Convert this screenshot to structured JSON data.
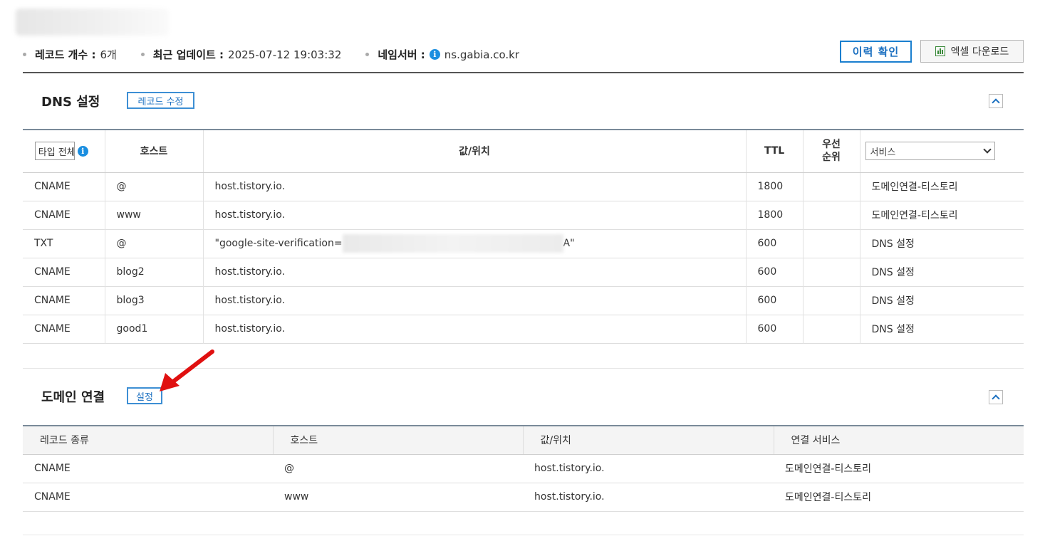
{
  "summary": {
    "record_count_label": "레코드 개수 :",
    "record_count_value": "6개",
    "last_update_label": "최근 업데이트 :",
    "last_update_value": "2025-07-12 19:03:32",
    "nameserver_label": "네임서버 :",
    "nameserver_value": "ns.gabia.co.kr"
  },
  "buttons": {
    "history": "이력 확인",
    "excel_download": "엑셀 다운로드"
  },
  "dns": {
    "title": "DNS 설정",
    "edit_button": "레코드 수정",
    "headers": {
      "type_select": "타입 전체",
      "host": "호스트",
      "value": "값/위치",
      "ttl": "TTL",
      "priority_line1": "우선",
      "priority_line2": "순위",
      "service_select": "서비스"
    },
    "rows": [
      {
        "type": "CNAME",
        "host": "@",
        "value": "host.tistory.io.",
        "ttl": "1800",
        "priority": "",
        "service": "도메인연결-티스토리"
      },
      {
        "type": "CNAME",
        "host": "www",
        "value": "host.tistory.io.",
        "ttl": "1800",
        "priority": "",
        "service": "도메인연결-티스토리"
      },
      {
        "type": "TXT",
        "host": "@",
        "value_prefix": "\"google-site-verification=",
        "value_suffix": "A\"",
        "ttl": "600",
        "priority": "",
        "service": "DNS 설정"
      },
      {
        "type": "CNAME",
        "host": "blog2",
        "value": "host.tistory.io.",
        "ttl": "600",
        "priority": "",
        "service": "DNS 설정"
      },
      {
        "type": "CNAME",
        "host": "blog3",
        "value": "host.tistory.io.",
        "ttl": "600",
        "priority": "",
        "service": "DNS 설정"
      },
      {
        "type": "CNAME",
        "host": "good1",
        "value": "host.tistory.io.",
        "ttl": "600",
        "priority": "",
        "service": "DNS 설정"
      }
    ]
  },
  "domain_link": {
    "title": "도메인 연결",
    "setting_button": "설정",
    "headers": {
      "record_type": "레코드 종류",
      "host": "호스트",
      "value": "값/위치",
      "service": "연결 서비스"
    },
    "rows": [
      {
        "type": "CNAME",
        "host": "@",
        "value": "host.tistory.io.",
        "service": "도메인연결-티스토리"
      },
      {
        "type": "CNAME",
        "host": "www",
        "value": "host.tistory.io.",
        "service": "도메인연결-티스토리"
      }
    ]
  },
  "colors": {
    "accent": "#1a6fc0",
    "annotation_arrow": "#e01010"
  }
}
